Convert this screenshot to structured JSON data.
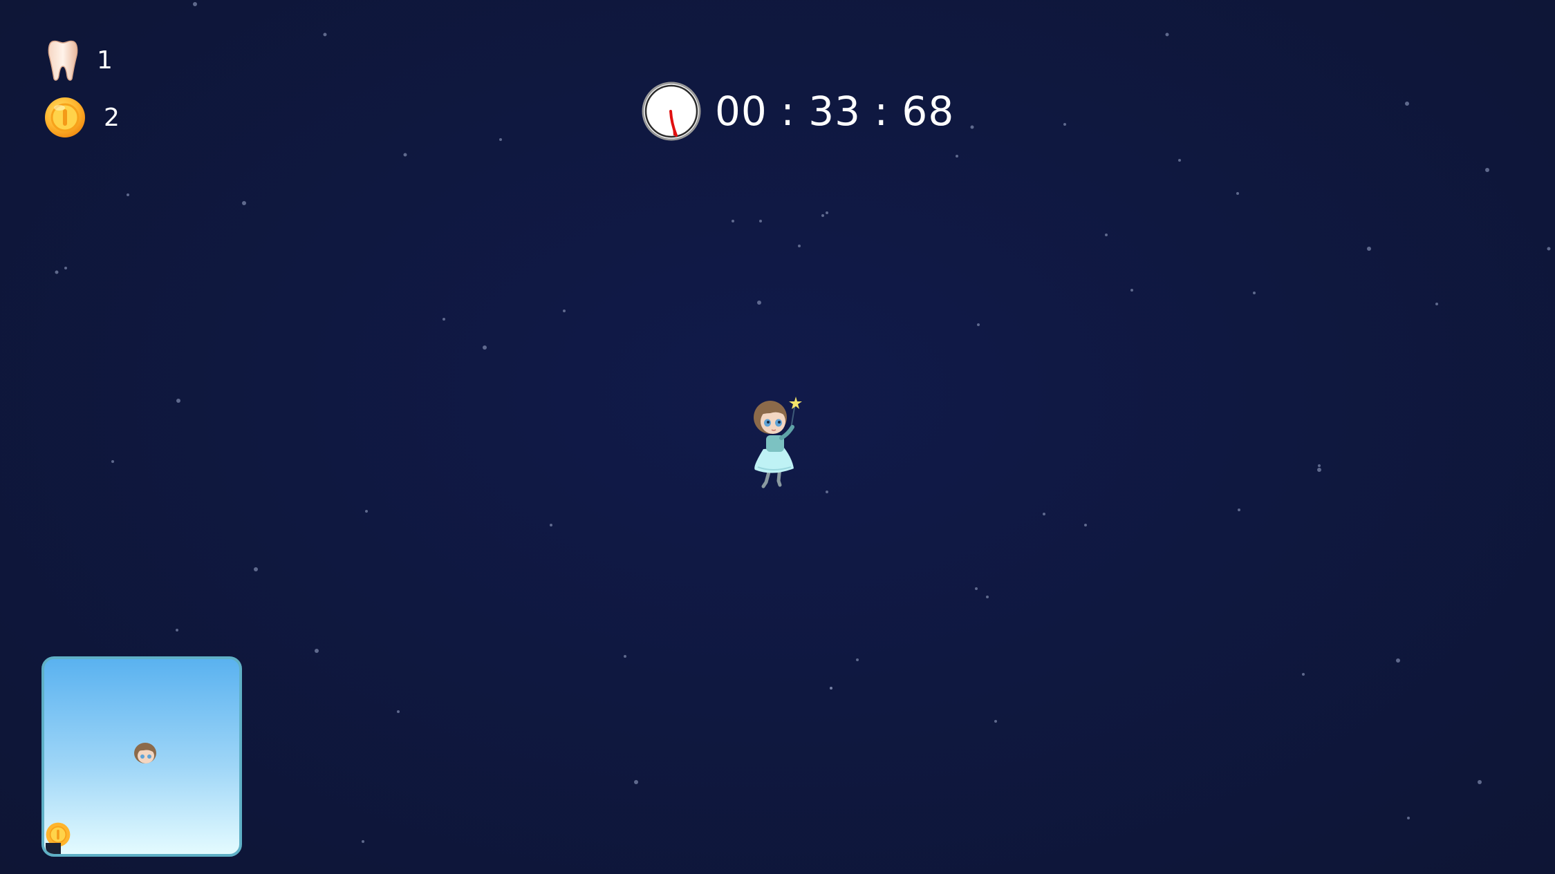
{
  "hud": {
    "teeth": {
      "icon": "tooth-icon",
      "count": "1"
    },
    "coins": {
      "icon": "coin-icon",
      "count": "2"
    }
  },
  "timer": {
    "icon": "stopwatch-icon",
    "text": "00 : 33 : 68"
  },
  "player": {
    "icon": "tooth-fairy-character"
  },
  "minimap": {
    "player_icon": "fairy-head-icon",
    "coin_icon": "coin-icon"
  },
  "colors": {
    "sky": "#0f1840",
    "minimap_top": "#5ab2f0",
    "minimap_bottom": "#e4fbff",
    "minimap_border": "#5fb0c6",
    "coin": "#f5a623",
    "timer_hand": "#e01010"
  }
}
